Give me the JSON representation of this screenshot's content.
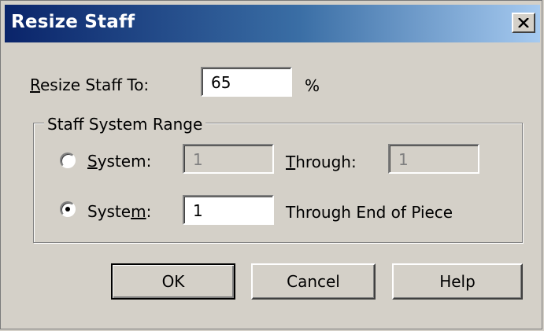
{
  "window": {
    "title": "Resize Staff",
    "close_icon": "close-icon"
  },
  "resize": {
    "label_underlined": "R",
    "label_rest": "esize Staff To:",
    "value": "65",
    "unit": "%"
  },
  "range": {
    "legend": "Staff System Range",
    "option1": {
      "label_underlined": "S",
      "label_rest": "ystem:",
      "from_value": "1",
      "through_label_underlined": "T",
      "through_label_rest": "hrough:",
      "through_value": "1",
      "selected": false
    },
    "option2": {
      "label_prefix": "Syste",
      "label_underlined": "m",
      "label_suffix": ":",
      "from_value": "1",
      "through_text": "Through End of Piece",
      "selected": true
    }
  },
  "buttons": {
    "ok": "OK",
    "cancel": "Cancel",
    "help": "Help"
  }
}
